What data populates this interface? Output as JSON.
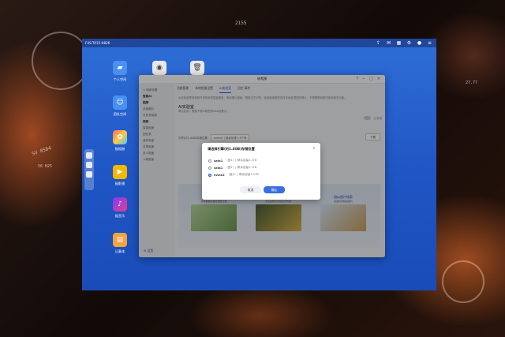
{
  "desktop": {
    "device_name": "F4S-TA15-6826",
    "desktop_icons": [
      {
        "label": "个人空间",
        "icon": "folder-icon",
        "color": "#4a90f0"
      },
      {
        "label": "团队空间",
        "icon": "team-folder-icon",
        "color": "#4a90f0"
      },
      {
        "label": "极相册",
        "icon": "photos-icon",
        "color": "#f6a623"
      },
      {
        "label": "极影视",
        "icon": "video-icon",
        "color": "#f5b800"
      },
      {
        "label": "极音乐",
        "icon": "music-icon",
        "color": "#e0408a"
      },
      {
        "label": "记事本",
        "icon": "notes-icon",
        "color": "#f4a340"
      }
    ],
    "accent": "#2f6ed6"
  },
  "app": {
    "title": "极相册",
    "tabs": [
      {
        "label": "功能管理"
      },
      {
        "label": "本地相册设置"
      },
      {
        "label": "AI实验室",
        "active": true
      },
      {
        "label": "回忆 事件"
      }
    ],
    "sidebar": {
      "back": "< 相册设置",
      "groups": [
        {
          "label": "智能AI",
          "items": []
        },
        {
          "label": "图库",
          "items": [
            "全部照片",
            "文件夹相册"
          ]
        },
        {
          "label": "相册",
          "items": [
            "智能相册",
            "回忆录",
            "我的相册",
            "共享相册",
            "多人相册",
            "人物相册"
          ]
        }
      ],
      "settings": "⚙ 设置"
    },
    "intro_text": "AI实验室是极相册开放的新型智能服务，例如图片搜索、图像文字识别，连续使用模型将在本地处理您的照片。不需要联网即可使用相关功能。",
    "section_title": "AI实验室",
    "toggle_label": "已关闭",
    "sub_text": "单击启用，需要下载AI模型到NAS设备中。",
    "model_select_label": "引擎(约1.4GB)存储位置:",
    "model_select_value": "nvme2 | 剩余存储 2.57TB",
    "download_button": "下载",
    "cards": [
      {
        "title": "智能相册",
        "subtitle": "对所有照片进行智能分类",
        "color": "#7aa860"
      },
      {
        "title": "图片文字识别",
        "subtitle": "可识别照片中的文字内容",
        "color": "#6a8f5a"
      },
      {
        "title": "相似图片搜索",
        "subtitle": "快速找到相似图片",
        "color": "#5a7bb8"
      }
    ]
  },
  "dialog": {
    "title": "请选择引擎(约1.4GB)存储位置",
    "options": [
      {
        "name": "sata1",
        "detail": "（盘1）| 剩余容量2.1TB",
        "selected": false
      },
      {
        "name": "sata1",
        "detail": "（盘1）| 剩余容量2.1TB",
        "selected": false
      },
      {
        "name": "nvme2",
        "detail": "（盘2）| 剩余容量1.5TB",
        "selected": true
      }
    ],
    "cancel": "取消",
    "confirm": "确认"
  },
  "hud": {
    "top": "2155",
    "left1": "SV 0584",
    "left2": "56 H25",
    "right1": "27.77"
  }
}
